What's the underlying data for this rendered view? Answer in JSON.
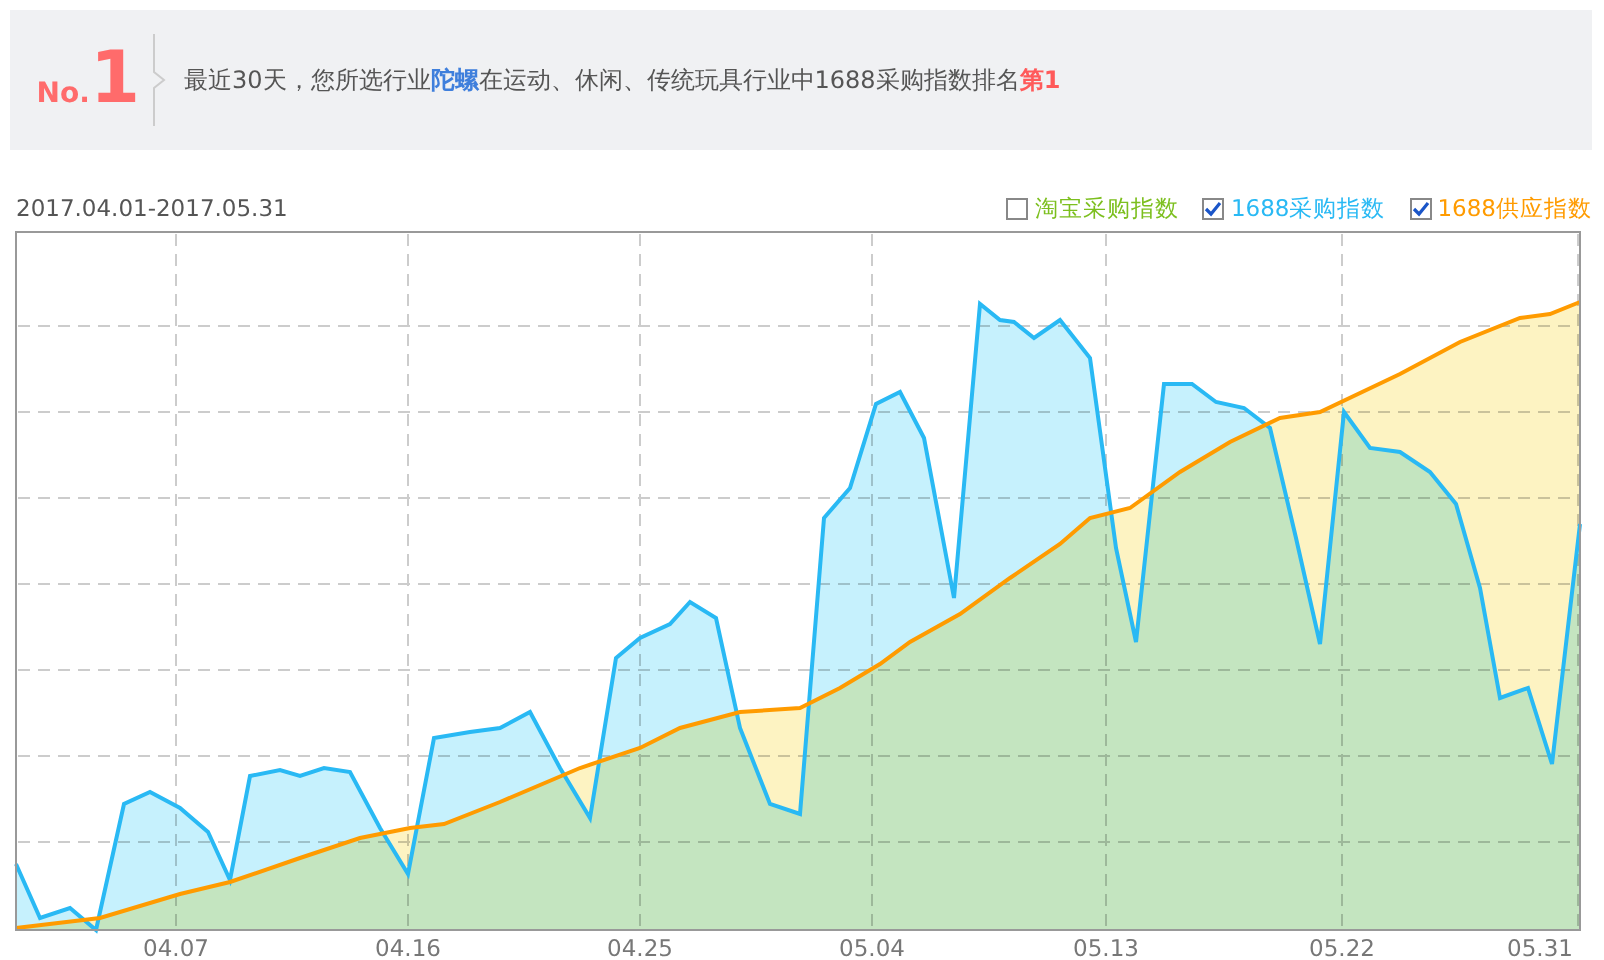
{
  "banner": {
    "no_label": "No.",
    "rank": "1",
    "sentence": [
      {
        "kind": "plain",
        "text": "最近30天，您所选行业"
      },
      {
        "kind": "category",
        "text": "陀螺"
      },
      {
        "kind": "plain",
        "text": "在运动、休闲、传统玩具行业中1688采购指数排名"
      },
      {
        "kind": "rank",
        "text": "第1"
      }
    ]
  },
  "chart": {
    "date_range": "2017.04.01-2017.05.31",
    "legend": [
      {
        "label": "淘宝采购指数",
        "checked": false,
        "color": "#7cbf1e"
      },
      {
        "label": "1688采购指数",
        "checked": true,
        "color": "#29b9f4"
      },
      {
        "label": "1688供应指数",
        "checked": true,
        "color": "#ff9b00"
      }
    ],
    "x_labels": [
      "04.07",
      "04.16",
      "04.25",
      "05.04",
      "05.13",
      "05.22",
      "05.31"
    ]
  }
}
